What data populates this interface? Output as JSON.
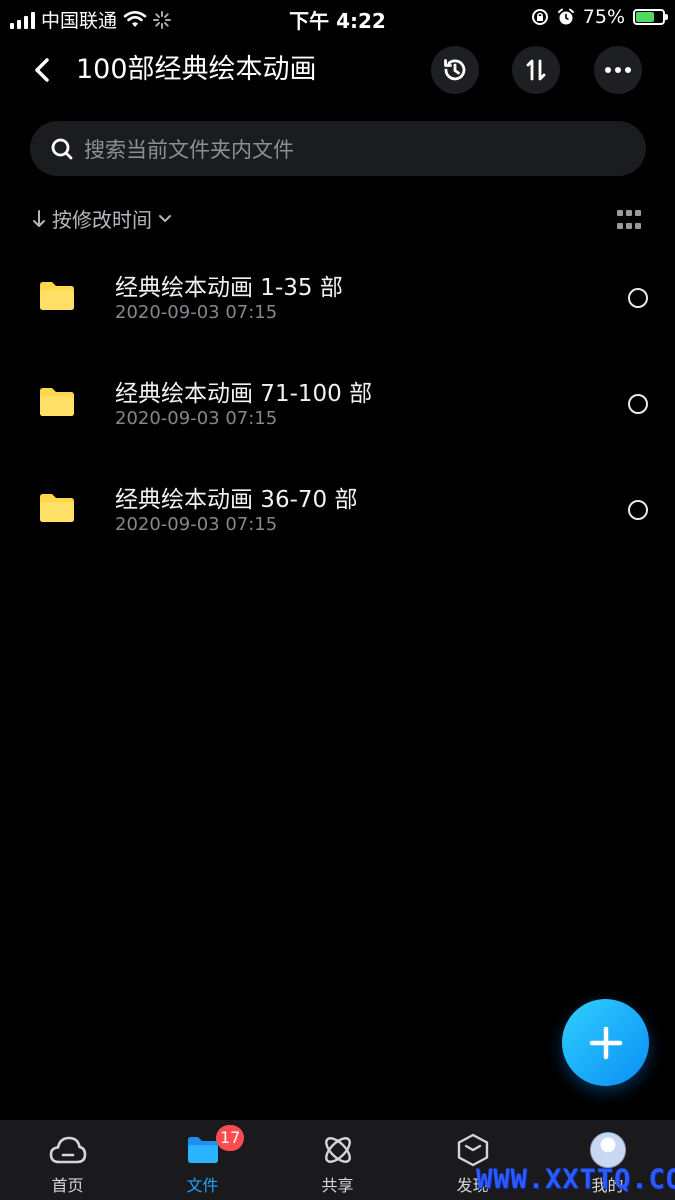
{
  "status_bar": {
    "carrier": "中国联通",
    "time": "下午 4:22",
    "battery_percent": "75%",
    "battery_level": 0.75,
    "icons": [
      "signal-icon",
      "wifi-icon",
      "loading-icon",
      "rotation-lock-icon",
      "alarm-icon",
      "battery-icon"
    ]
  },
  "header": {
    "title": "100部经典绘本动画",
    "icons": [
      "back-icon",
      "history-icon",
      "sort-icon",
      "more-icon"
    ]
  },
  "search": {
    "placeholder": "搜索当前文件夹内文件"
  },
  "sort": {
    "label": "按修改时间"
  },
  "files": [
    {
      "name": "经典绘本动画 1-35 部",
      "date": "2020-09-03 07:15",
      "icon": "folder-icon"
    },
    {
      "name": "经典绘本动画 71-100 部",
      "date": "2020-09-03 07:15",
      "icon": "folder-icon"
    },
    {
      "name": "经典绘本动画 36-70 部",
      "date": "2020-09-03 07:15",
      "icon": "folder-icon"
    }
  ],
  "nav": {
    "items": [
      {
        "label": "首页",
        "icon": "cloud-icon"
      },
      {
        "label": "文件",
        "icon": "folder-icon"
      },
      {
        "label": "共享",
        "icon": "atom-icon"
      },
      {
        "label": "发现",
        "icon": "box-icon"
      },
      {
        "label": "我的",
        "icon": "avatar"
      }
    ],
    "active": "文件",
    "share_badge": "17"
  },
  "watermark": "WWW.XXTTQ.COM",
  "colors": {
    "accent": "#1ea4ff",
    "folder": "#ffd74a",
    "badge": "#ff4d4f",
    "background": "#000000"
  }
}
